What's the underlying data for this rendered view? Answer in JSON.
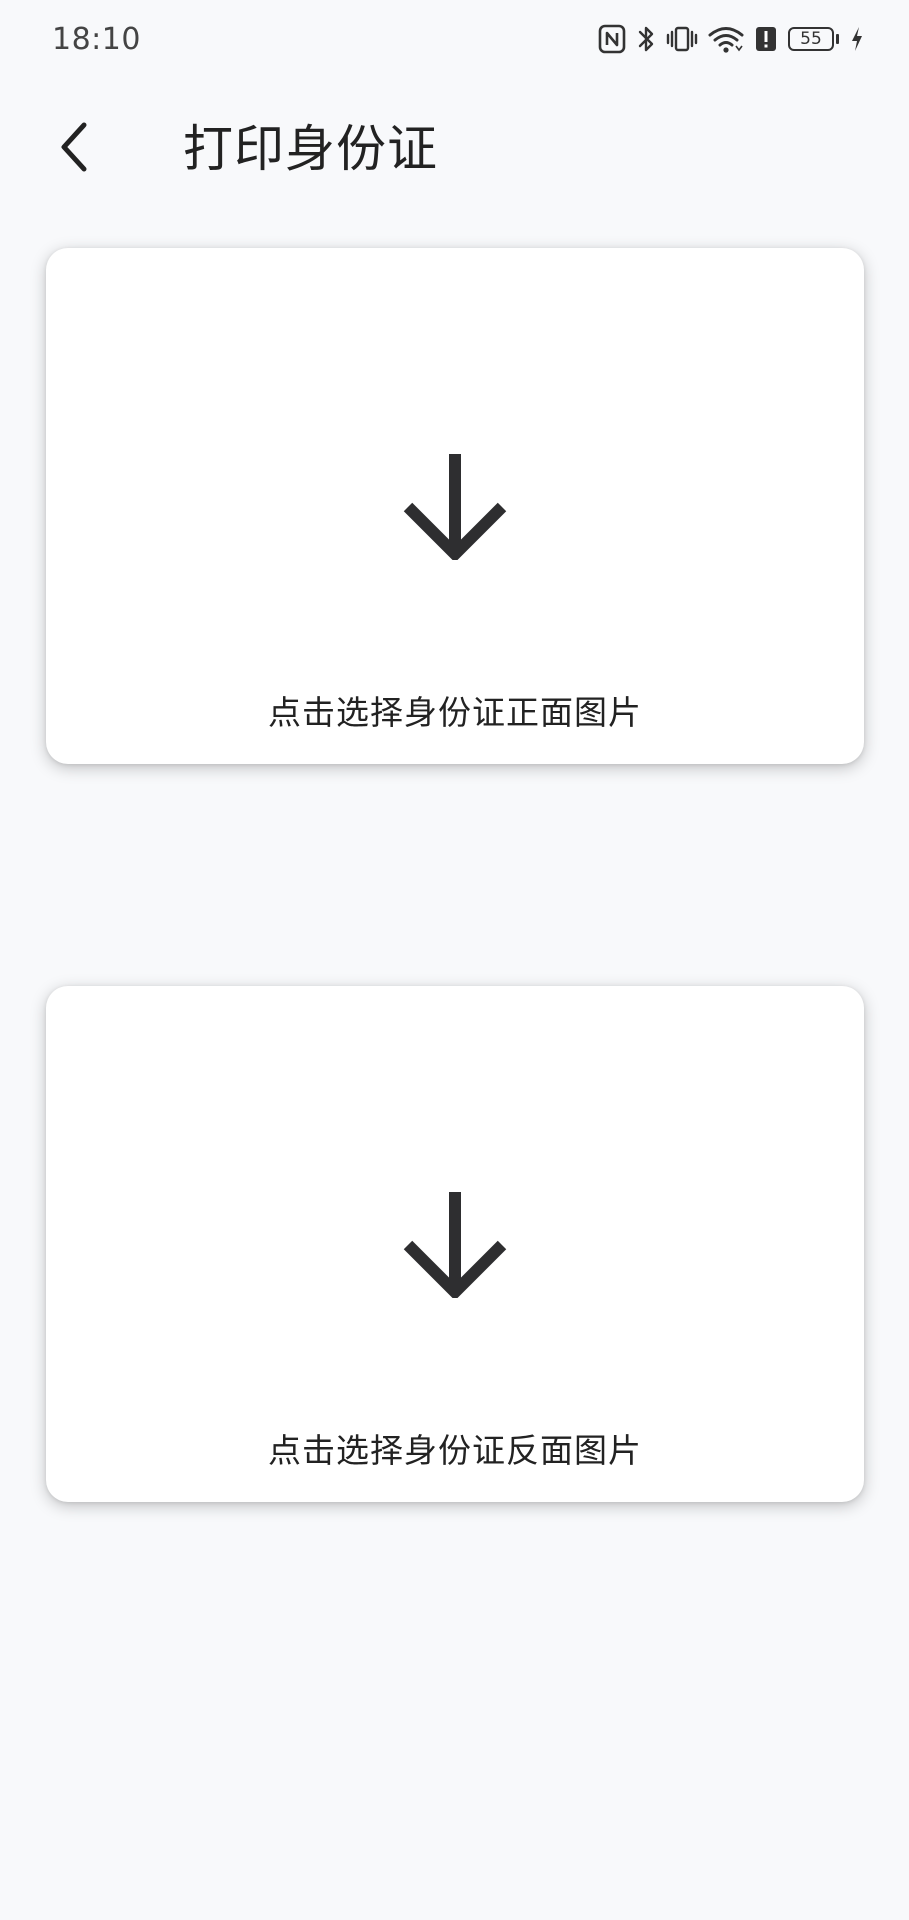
{
  "status_bar": {
    "time": "18:10",
    "battery_level": "55",
    "icons": [
      "nfc-icon",
      "bluetooth-icon",
      "vibrate-icon",
      "wifi-icon",
      "alert-icon",
      "battery-icon",
      "charging-icon"
    ]
  },
  "header": {
    "title": "打印身份证",
    "back_icon": "chevron-left-icon"
  },
  "cards": {
    "front": {
      "icon": "arrow-down-icon",
      "label": "点击选择身份证正面图片"
    },
    "back": {
      "icon": "arrow-down-icon",
      "label": "点击选择身份证反面图片"
    }
  },
  "colors": {
    "background": "#f8f9fb",
    "card": "#ffffff",
    "icon": "#2e2e30",
    "text": "#222222"
  }
}
